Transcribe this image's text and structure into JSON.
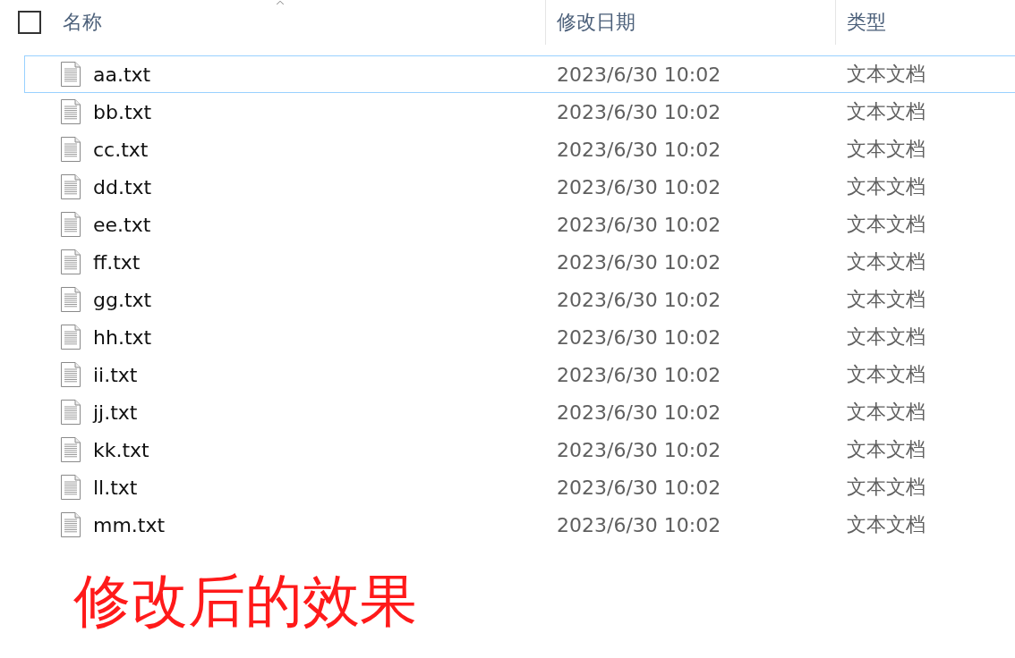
{
  "header": {
    "select_all": {
      "checked": false
    },
    "columns": [
      "名称",
      "修改日期",
      "类型"
    ]
  },
  "files": [
    {
      "name": "aa.txt",
      "modified": "2023/6/30 10:02",
      "type": "文本文档",
      "focused": true
    },
    {
      "name": "bb.txt",
      "modified": "2023/6/30 10:02",
      "type": "文本文档",
      "focused": false
    },
    {
      "name": "cc.txt",
      "modified": "2023/6/30 10:02",
      "type": "文本文档",
      "focused": false
    },
    {
      "name": "dd.txt",
      "modified": "2023/6/30 10:02",
      "type": "文本文档",
      "focused": false
    },
    {
      "name": "ee.txt",
      "modified": "2023/6/30 10:02",
      "type": "文本文档",
      "focused": false
    },
    {
      "name": "ff.txt",
      "modified": "2023/6/30 10:02",
      "type": "文本文档",
      "focused": false
    },
    {
      "name": "gg.txt",
      "modified": "2023/6/30 10:02",
      "type": "文本文档",
      "focused": false
    },
    {
      "name": "hh.txt",
      "modified": "2023/6/30 10:02",
      "type": "文本文档",
      "focused": false
    },
    {
      "name": "ii.txt",
      "modified": "2023/6/30 10:02",
      "type": "文本文档",
      "focused": false
    },
    {
      "name": "jj.txt",
      "modified": "2023/6/30 10:02",
      "type": "文本文档",
      "focused": false
    },
    {
      "name": "kk.txt",
      "modified": "2023/6/30 10:02",
      "type": "文本文档",
      "focused": false
    },
    {
      "name": "ll.txt",
      "modified": "2023/6/30 10:02",
      "type": "文本文档",
      "focused": false
    },
    {
      "name": "mm.txt",
      "modified": "2023/6/30 10:02",
      "type": "文本文档",
      "focused": false
    }
  ],
  "caption": "修改后的效果"
}
